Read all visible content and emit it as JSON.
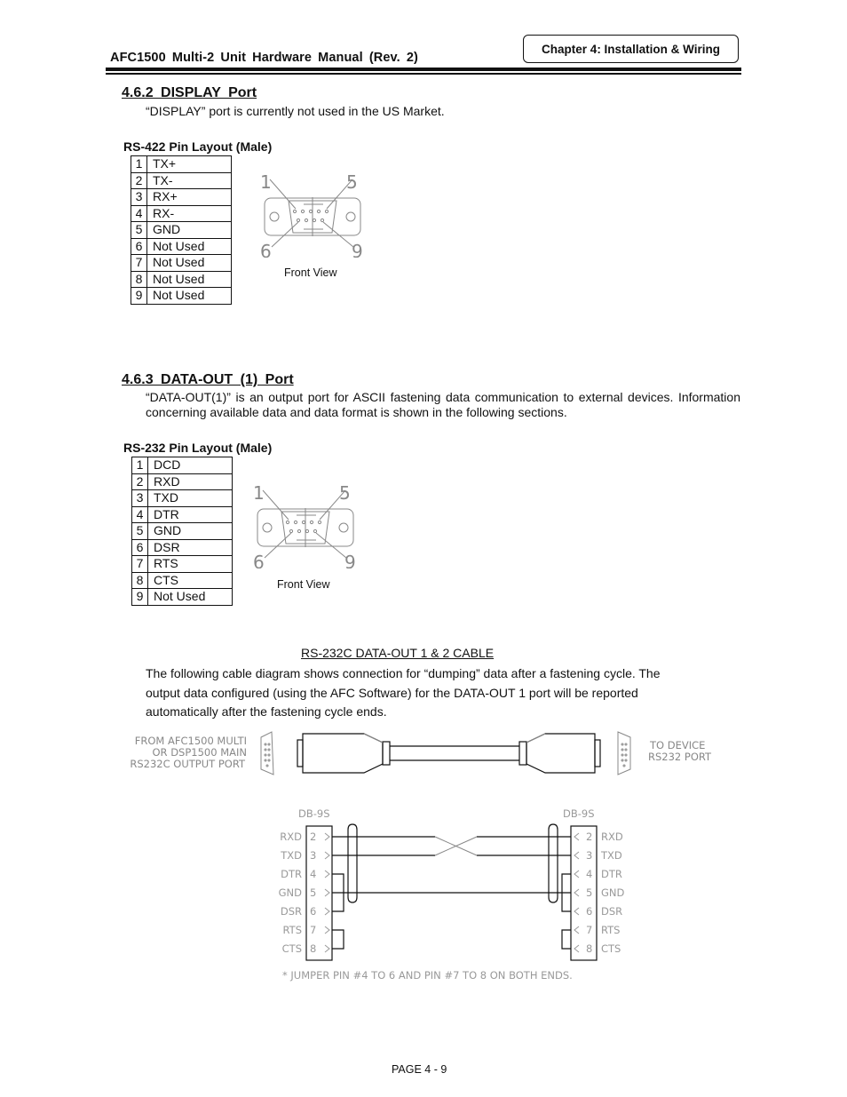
{
  "header": {
    "manual_title": "AFC1500  Multi-2  Unit  Hardware  Manual  (Rev.  2)",
    "chapter": "Chapter 4: Installation & Wiring"
  },
  "display_port": {
    "heading": "4.6.2   DISPLAY  Port",
    "description": "“DISPLAY” port is currently not used in the US Market.",
    "layout_label": "RS-422 Pin Layout (Male)",
    "pins": [
      {
        "num": "1",
        "signal": "TX+"
      },
      {
        "num": "2",
        "signal": "TX-"
      },
      {
        "num": "3",
        "signal": "RX+"
      },
      {
        "num": "4",
        "signal": "RX-"
      },
      {
        "num": "5",
        "signal": "GND"
      },
      {
        "num": "6",
        "signal": "Not Used"
      },
      {
        "num": "7",
        "signal": "Not Used"
      },
      {
        "num": "8",
        "signal": "Not Used"
      },
      {
        "num": "9",
        "signal": "Not Used"
      }
    ],
    "connector": {
      "labels": [
        "1",
        "5",
        "6",
        "9"
      ],
      "caption": "Front View"
    }
  },
  "data_out_port": {
    "heading": "4.6.3   DATA-OUT  (1)  Port",
    "description": "“DATA-OUT(1)” is an output port for ASCII fastening data communication to external devices. Information concerning available data and data format is shown in the following sections.",
    "layout_label": "RS-232 Pin Layout (Male)",
    "pins": [
      {
        "num": "1",
        "signal": "DCD"
      },
      {
        "num": "2",
        "signal": "RXD"
      },
      {
        "num": "3",
        "signal": "TXD"
      },
      {
        "num": "4",
        "signal": "DTR"
      },
      {
        "num": "5",
        "signal": "GND"
      },
      {
        "num": "6",
        "signal": "DSR"
      },
      {
        "num": "7",
        "signal": "RTS"
      },
      {
        "num": "8",
        "signal": "CTS"
      },
      {
        "num": "9",
        "signal": "Not Used"
      }
    ],
    "connector": {
      "labels": [
        "1",
        "5",
        "6",
        "9"
      ],
      "caption": "Front View"
    }
  },
  "cable": {
    "title": "RS-232C DATA-OUT 1 & 2 CABLE",
    "description_lines": [
      "The following cable diagram shows connection for “dumping” data after a fastening cycle.    The",
      "output data configured (using the AFC Software) for the DATA-OUT 1 port will be reported",
      "automatically after the fastening cycle ends."
    ],
    "from_label": [
      "FROM  AFC1500  MULTI",
      "OR  DSP1500  MAIN",
      "RS232C  OUTPUT  PORT"
    ],
    "to_label": [
      "TO  DEVICE",
      "RS232  PORT"
    ],
    "wiring": {
      "left_connector": "DB-9S",
      "right_connector": "DB-9S",
      "rows": [
        {
          "signal": "RXD",
          "pin": "2"
        },
        {
          "signal": "TXD",
          "pin": "3"
        },
        {
          "signal": "DTR",
          "pin": "4"
        },
        {
          "signal": "GND",
          "pin": "5"
        },
        {
          "signal": "DSR",
          "pin": "6"
        },
        {
          "signal": "RTS",
          "pin": "7"
        },
        {
          "signal": "CTS",
          "pin": "8"
        }
      ],
      "note": "*  JUMPER  PIN  #4  TO  6  AND  PIN  #7  TO  8  ON  BOTH  ENDS."
    }
  },
  "footer": {
    "page": "PAGE 4 - 9"
  }
}
